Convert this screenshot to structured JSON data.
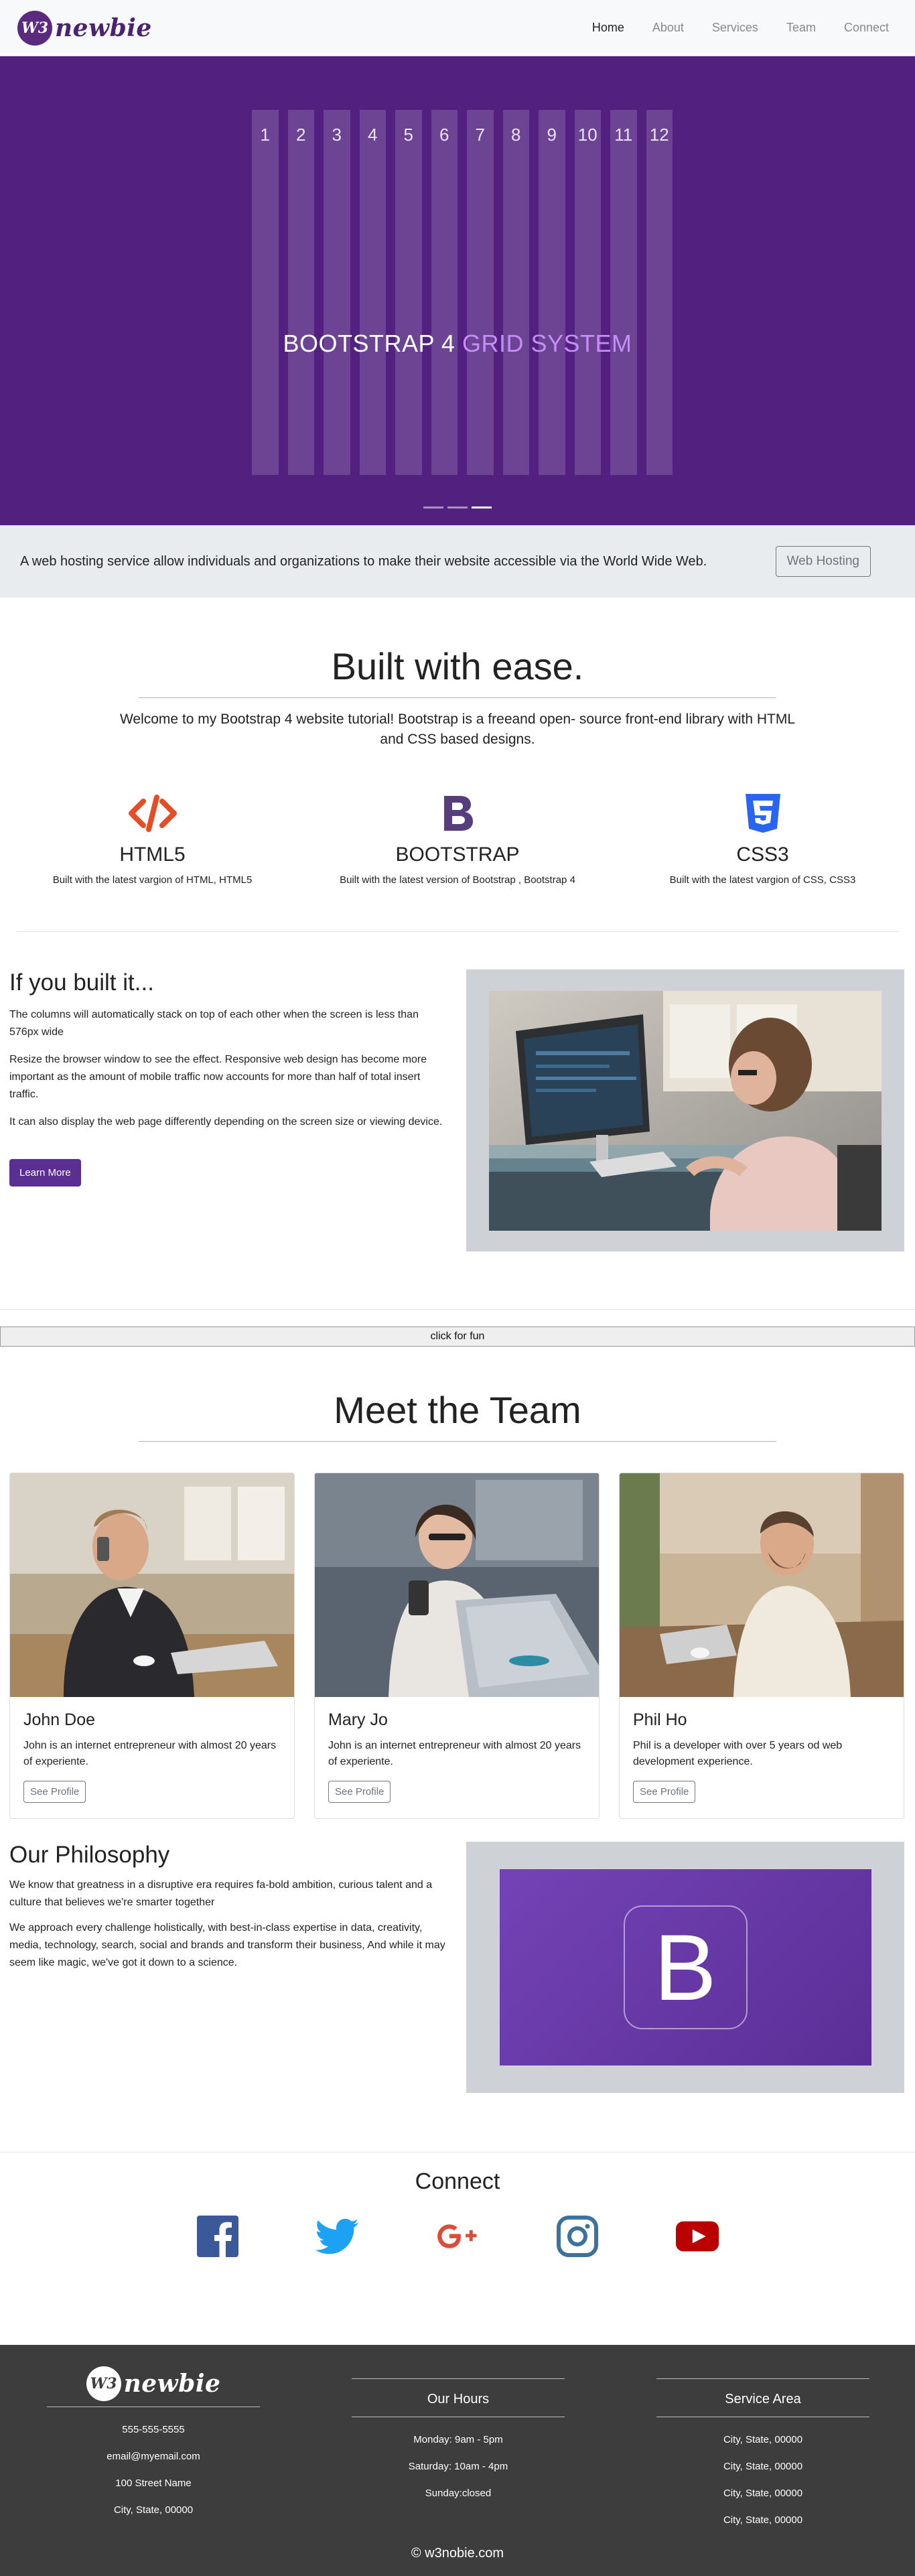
{
  "brand": {
    "badge": "W3",
    "name": "newbie"
  },
  "nav": [
    {
      "label": "Home",
      "active": true
    },
    {
      "label": "About",
      "active": false
    },
    {
      "label": "Services",
      "active": false
    },
    {
      "label": "Team",
      "active": false
    },
    {
      "label": "Connect",
      "active": false
    }
  ],
  "hero": {
    "columns": [
      "1",
      "2",
      "3",
      "4",
      "5",
      "6",
      "7",
      "8",
      "9",
      "10",
      "11",
      "12"
    ],
    "title_main": "BOOTSTRAP 4 ",
    "title_accent": "GRID SYSTEM",
    "slides": 3,
    "active_slide": 3
  },
  "jumbo": {
    "text": "A web hosting service allow individuals and organizations to make their website accessible via the World Wide Web.",
    "button": "Web Hosting"
  },
  "welcome": {
    "title": "Built with ease.",
    "text": "Welcome to my Bootstrap 4 website tutorial! Bootstrap is a freeand open- source front-end library with HTML and CSS based designs."
  },
  "features": [
    {
      "icon": "html5-icon",
      "title": "HTML5",
      "text": "Built with the latest vargion of HTML, HTML5",
      "color": "#e44d26"
    },
    {
      "icon": "bootstrap-icon",
      "title": "BOOTSTRAP",
      "text": "Built with the latest version of Bootstrap , Bootstrap 4",
      "color": "#563d7c"
    },
    {
      "icon": "css3-icon",
      "title": "CSS3",
      "text": "Built with the latest vargion of CSS, CSS3",
      "color": "#2965f1"
    }
  ],
  "built": {
    "title": "If you built it...",
    "p1": "The columns will automatically stack on top of each other when the screen is less than 576px wide",
    "p2": "Resize the browser window to see the effect. Responsive web design has become more important as the amount of mobile traffic now accounts for more than half of total insert traffic.",
    "p3": "It can also display the web page differently depending on the screen size or viewing device.",
    "button": "Learn More"
  },
  "fun_button": "click for fun",
  "team": {
    "title": "Meet the Team",
    "members": [
      {
        "name": "John Doe",
        "bio": "John is an internet entrepreneur with almost 20 years of experiente.",
        "button": "See Profile"
      },
      {
        "name": "Mary Jo",
        "bio": "John is an internet entrepreneur with almost 20 years of experiente.",
        "button": "See Profile"
      },
      {
        "name": "Phil Ho",
        "bio": "Phil is a developer with over 5 years od web development experience.",
        "button": "See Profile"
      }
    ]
  },
  "philosophy": {
    "title": "Our Philosophy",
    "p1": "We know that greatness in a disruptive era requires fa-bold ambition, curious talent and a culture that believes we're smarter together",
    "p2": "We approach every challenge holistically, with best-in-class expertise in data, creativity, media, technology, search, social and brands and transform their business, And while it may seem like magic, we've got it down to a science.",
    "logo_letter": "B"
  },
  "connect": {
    "title": "Connect",
    "icons": [
      {
        "name": "facebook-icon",
        "color": "#3b5998"
      },
      {
        "name": "twitter-icon",
        "color": "#1da1f2"
      },
      {
        "name": "google-plus-icon",
        "color": "#dd4b39"
      },
      {
        "name": "instagram-icon",
        "color": "#3f729b"
      },
      {
        "name": "youtube-icon",
        "color": "#bb0000"
      }
    ]
  },
  "footer": {
    "contact": [
      "555-555-5555",
      "email@myemail.com",
      "100 Street Name",
      "City, State, 00000"
    ],
    "hours_title": "Our Hours",
    "hours": [
      "Monday: 9am - 5pm",
      "Saturday: 10am - 4pm",
      "Sunday:closed"
    ],
    "area_title": "Service Area",
    "areas": [
      "City, State, 00000",
      "City, State, 00000",
      "City, State, 00000",
      "City, State, 00000"
    ],
    "copyright": "© w3nobie.com"
  }
}
